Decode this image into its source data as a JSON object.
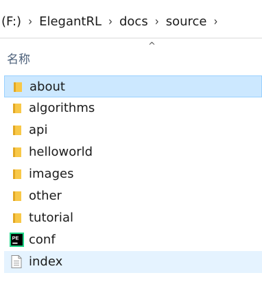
{
  "breadcrumb": {
    "items": [
      "(F:)",
      "ElegantRL",
      "docs",
      "source"
    ]
  },
  "header": {
    "name_column": "名称",
    "sort_indicator": "^"
  },
  "files": [
    {
      "name": "about",
      "type": "folder"
    },
    {
      "name": "algorithms",
      "type": "folder"
    },
    {
      "name": "api",
      "type": "folder"
    },
    {
      "name": "helloworld",
      "type": "folder"
    },
    {
      "name": "images",
      "type": "folder"
    },
    {
      "name": "other",
      "type": "folder"
    },
    {
      "name": "tutorial",
      "type": "folder"
    },
    {
      "name": "conf",
      "type": "python-file"
    },
    {
      "name": "index",
      "type": "text-file"
    }
  ],
  "colors": {
    "selected_bg": "#cce8ff",
    "selected_border": "#99d1ff",
    "hover_bg": "#e5f3ff",
    "folder": "#f8c848"
  }
}
